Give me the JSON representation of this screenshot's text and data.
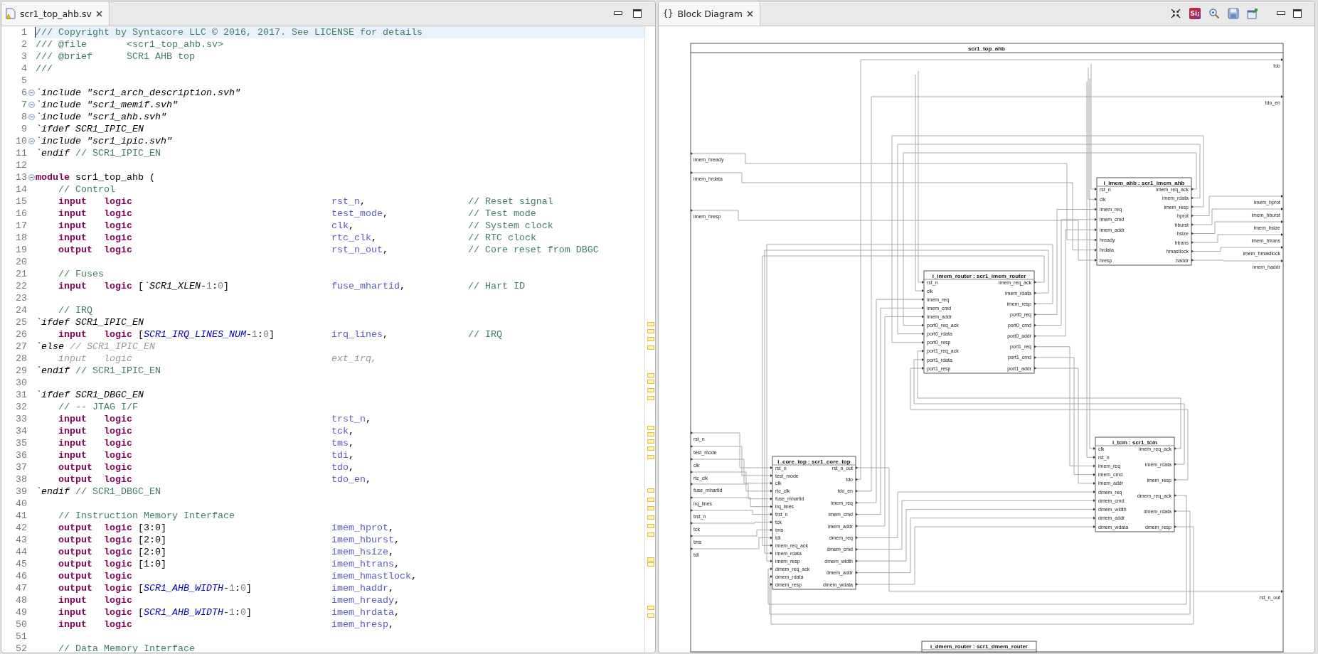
{
  "editor": {
    "tab": {
      "title": "scr1_top_ahb.sv",
      "selected": true
    },
    "lines": [
      {
        "number": "1",
        "current": true,
        "fold": false,
        "segments": [
          {
            "kind": "comment",
            "text": "/// Copyright by Syntacore LLC © 2016, 2017. See LICENSE for details"
          }
        ]
      },
      {
        "number": "2",
        "current": false,
        "fold": false,
        "segments": [
          {
            "kind": "comment",
            "text": "/// @file       <scr1_top_ahb.sv>"
          }
        ]
      },
      {
        "number": "3",
        "current": false,
        "fold": false,
        "segments": [
          {
            "kind": "comment",
            "text": "/// @brief      SCR1 AHB top"
          }
        ]
      },
      {
        "number": "4",
        "current": false,
        "fold": false,
        "segments": [
          {
            "kind": "comment",
            "text": "///"
          }
        ]
      },
      {
        "number": "5",
        "current": false,
        "fold": false
      },
      {
        "number": "6",
        "current": false,
        "fold": true,
        "segments": [
          {
            "kind": "directive",
            "text": "`include \"scr1_arch_description.svh\""
          }
        ]
      },
      {
        "number": "7",
        "current": false,
        "fold": true,
        "segments": [
          {
            "kind": "directive",
            "text": "`include \"scr1_memif.svh\""
          }
        ]
      },
      {
        "number": "8",
        "current": false,
        "fold": true,
        "segments": [
          {
            "kind": "directive",
            "text": "`include \"scr1_ahb.svh\""
          }
        ]
      },
      {
        "number": "9",
        "current": false,
        "fold": false,
        "segments": [
          {
            "kind": "directive",
            "text": "`ifdef SCR1_IPIC_EN"
          }
        ]
      },
      {
        "number": "10",
        "current": false,
        "fold": true,
        "segments": [
          {
            "kind": "directive",
            "text": "`include \"scr1_ipic.svh\""
          }
        ]
      },
      {
        "number": "11",
        "current": false,
        "fold": false,
        "segments": [
          {
            "kind": "directive",
            "text": "`endif"
          },
          {
            "kind": "comment",
            "text": " // SCR1_IPIC_EN"
          }
        ]
      },
      {
        "number": "12",
        "current": false,
        "fold": false
      },
      {
        "number": "13",
        "current": false,
        "fold": true,
        "segments": [
          {
            "kind": "keyword",
            "text": "module"
          },
          {
            "kind": "plain",
            "text": " scr1_top_ahb ("
          }
        ]
      },
      {
        "number": "14",
        "current": false,
        "fold": false,
        "segments": [
          {
            "kind": "comment",
            "text": "    // Control"
          }
        ]
      },
      {
        "number": "15",
        "current": false,
        "fold": false,
        "segments": [
          {
            "kind": "keyword",
            "text": "    input"
          },
          {
            "kind": "keyword",
            "text": "   logic"
          },
          {
            "kind": "port",
            "text": "                                   rst_n"
          },
          {
            "kind": "plain",
            "text": ",                  "
          },
          {
            "kind": "comment",
            "text": "// Reset signal"
          }
        ]
      },
      {
        "number": "16",
        "current": false,
        "fold": false,
        "segments": [
          {
            "kind": "keyword",
            "text": "    input"
          },
          {
            "kind": "keyword",
            "text": "   logic"
          },
          {
            "kind": "port",
            "text": "                                   test_mode"
          },
          {
            "kind": "plain",
            "text": ",              "
          },
          {
            "kind": "comment",
            "text": "// Test mode"
          }
        ]
      },
      {
        "number": "17",
        "current": false,
        "fold": false,
        "segments": [
          {
            "kind": "keyword",
            "text": "    input"
          },
          {
            "kind": "keyword",
            "text": "   logic"
          },
          {
            "kind": "port",
            "text": "                                   clk"
          },
          {
            "kind": "plain",
            "text": ",                    "
          },
          {
            "kind": "comment",
            "text": "// System clock"
          }
        ]
      },
      {
        "number": "18",
        "current": false,
        "fold": false,
        "segments": [
          {
            "kind": "keyword",
            "text": "    input"
          },
          {
            "kind": "keyword",
            "text": "   logic"
          },
          {
            "kind": "port",
            "text": "                                   rtc_clk"
          },
          {
            "kind": "plain",
            "text": ",                "
          },
          {
            "kind": "comment",
            "text": "// RTC clock"
          }
        ]
      },
      {
        "number": "19",
        "current": false,
        "fold": false,
        "segments": [
          {
            "kind": "keyword",
            "text": "    output"
          },
          {
            "kind": "keyword",
            "text": "  logic"
          },
          {
            "kind": "port",
            "text": "                                   rst_n_out"
          },
          {
            "kind": "plain",
            "text": ",              "
          },
          {
            "kind": "comment",
            "text": "// Core reset from DBGC"
          }
        ]
      },
      {
        "number": "20",
        "current": false,
        "fold": false
      },
      {
        "number": "21",
        "current": false,
        "fold": false,
        "segments": [
          {
            "kind": "comment",
            "text": "    // Fuses"
          }
        ]
      },
      {
        "number": "22",
        "current": false,
        "fold": false,
        "segments": [
          {
            "kind": "keyword",
            "text": "    input"
          },
          {
            "kind": "keyword",
            "text": "   logic"
          },
          {
            "kind": "plain",
            "text": " ["
          },
          {
            "kind": "directive",
            "text": "`SCR1_XLEN"
          },
          {
            "kind": "plain",
            "text": "-"
          },
          {
            "kind": "number",
            "text": "1"
          },
          {
            "kind": "plain",
            "text": ":"
          },
          {
            "kind": "number",
            "text": "0"
          },
          {
            "kind": "plain",
            "text": "]"
          },
          {
            "kind": "port",
            "text": "                  fuse_mhartid"
          },
          {
            "kind": "plain",
            "text": ",           "
          },
          {
            "kind": "comment",
            "text": "// Hart ID"
          }
        ]
      },
      {
        "number": "23",
        "current": false,
        "fold": false
      },
      {
        "number": "24",
        "current": false,
        "fold": false,
        "segments": [
          {
            "kind": "comment",
            "text": "    // IRQ"
          }
        ]
      },
      {
        "number": "25",
        "current": false,
        "fold": false,
        "segments": [
          {
            "kind": "directive",
            "text": "`ifdef SCR1_IPIC_EN"
          }
        ]
      },
      {
        "number": "26",
        "current": false,
        "fold": false,
        "segments": [
          {
            "kind": "keyword",
            "text": "    input"
          },
          {
            "kind": "keyword",
            "text": "   logic"
          },
          {
            "kind": "plain",
            "text": " ["
          },
          {
            "kind": "macro",
            "text": "SCR1_IRQ_LINES_NUM"
          },
          {
            "kind": "plain",
            "text": "-"
          },
          {
            "kind": "number",
            "text": "1"
          },
          {
            "kind": "plain",
            "text": ":"
          },
          {
            "kind": "number",
            "text": "0"
          },
          {
            "kind": "plain",
            "text": "]"
          },
          {
            "kind": "port",
            "text": "          irq_lines"
          },
          {
            "kind": "plain",
            "text": ",              "
          },
          {
            "kind": "comment",
            "text": "// IRQ"
          }
        ]
      },
      {
        "number": "27",
        "current": false,
        "fold": false,
        "segments": [
          {
            "kind": "directive",
            "text": "`else"
          },
          {
            "kind": "inactive",
            "text": " // SCR1_IPIC_EN"
          }
        ]
      },
      {
        "number": "28",
        "current": false,
        "fold": false,
        "segments": [
          {
            "kind": "inactive",
            "text": "    input   logic                                   ext_irq,"
          }
        ]
      },
      {
        "number": "29",
        "current": false,
        "fold": false,
        "segments": [
          {
            "kind": "directive",
            "text": "`endif"
          },
          {
            "kind": "comment",
            "text": " // SCR1_IPIC_EN"
          }
        ]
      },
      {
        "number": "30",
        "current": false,
        "fold": false
      },
      {
        "number": "31",
        "current": false,
        "fold": false,
        "segments": [
          {
            "kind": "directive",
            "text": "`ifdef SCR1_DBGC_EN"
          }
        ]
      },
      {
        "number": "32",
        "current": false,
        "fold": false,
        "segments": [
          {
            "kind": "comment",
            "text": "    // -- JTAG I/F"
          }
        ]
      },
      {
        "number": "33",
        "current": false,
        "fold": false,
        "segments": [
          {
            "kind": "keyword",
            "text": "    input"
          },
          {
            "kind": "keyword",
            "text": "   logic"
          },
          {
            "kind": "port",
            "text": "                                   trst_n"
          },
          {
            "kind": "plain",
            "text": ","
          }
        ]
      },
      {
        "number": "34",
        "current": false,
        "fold": false,
        "segments": [
          {
            "kind": "keyword",
            "text": "    input"
          },
          {
            "kind": "keyword",
            "text": "   logic"
          },
          {
            "kind": "port",
            "text": "                                   tck"
          },
          {
            "kind": "plain",
            "text": ","
          }
        ]
      },
      {
        "number": "35",
        "current": false,
        "fold": false,
        "segments": [
          {
            "kind": "keyword",
            "text": "    input"
          },
          {
            "kind": "keyword",
            "text": "   logic"
          },
          {
            "kind": "port",
            "text": "                                   tms"
          },
          {
            "kind": "plain",
            "text": ","
          }
        ]
      },
      {
        "number": "36",
        "current": false,
        "fold": false,
        "segments": [
          {
            "kind": "keyword",
            "text": "    input"
          },
          {
            "kind": "keyword",
            "text": "   logic"
          },
          {
            "kind": "port",
            "text": "                                   tdi"
          },
          {
            "kind": "plain",
            "text": ","
          }
        ]
      },
      {
        "number": "37",
        "current": false,
        "fold": false,
        "segments": [
          {
            "kind": "keyword",
            "text": "    output"
          },
          {
            "kind": "keyword",
            "text": "  logic"
          },
          {
            "kind": "port",
            "text": "                                   tdo"
          },
          {
            "kind": "plain",
            "text": ","
          }
        ]
      },
      {
        "number": "38",
        "current": false,
        "fold": false,
        "segments": [
          {
            "kind": "keyword",
            "text": "    output"
          },
          {
            "kind": "keyword",
            "text": "  logic"
          },
          {
            "kind": "port",
            "text": "                                   tdo_en"
          },
          {
            "kind": "plain",
            "text": ","
          }
        ]
      },
      {
        "number": "39",
        "current": false,
        "fold": false,
        "segments": [
          {
            "kind": "directive",
            "text": "`endif"
          },
          {
            "kind": "comment",
            "text": " // SCR1_DBGC_EN"
          }
        ]
      },
      {
        "number": "40",
        "current": false,
        "fold": false
      },
      {
        "number": "41",
        "current": false,
        "fold": false,
        "segments": [
          {
            "kind": "comment",
            "text": "    // Instruction Memory Interface"
          }
        ]
      },
      {
        "number": "42",
        "current": false,
        "fold": false,
        "segments": [
          {
            "kind": "keyword",
            "text": "    output"
          },
          {
            "kind": "keyword",
            "text": "  logic"
          },
          {
            "kind": "plain",
            "text": " [3:0]"
          },
          {
            "kind": "port",
            "text": "                             imem_hprot"
          },
          {
            "kind": "plain",
            "text": ","
          }
        ]
      },
      {
        "number": "43",
        "current": false,
        "fold": false,
        "segments": [
          {
            "kind": "keyword",
            "text": "    output"
          },
          {
            "kind": "keyword",
            "text": "  logic"
          },
          {
            "kind": "plain",
            "text": " [2:0]"
          },
          {
            "kind": "port",
            "text": "                             imem_hburst"
          },
          {
            "kind": "plain",
            "text": ","
          }
        ]
      },
      {
        "number": "44",
        "current": false,
        "fold": false,
        "segments": [
          {
            "kind": "keyword",
            "text": "    output"
          },
          {
            "kind": "keyword",
            "text": "  logic"
          },
          {
            "kind": "plain",
            "text": " [2:0]"
          },
          {
            "kind": "port",
            "text": "                             imem_hsize"
          },
          {
            "kind": "plain",
            "text": ","
          }
        ]
      },
      {
        "number": "45",
        "current": false,
        "fold": false,
        "segments": [
          {
            "kind": "keyword",
            "text": "    output"
          },
          {
            "kind": "keyword",
            "text": "  logic"
          },
          {
            "kind": "plain",
            "text": " [1:0]"
          },
          {
            "kind": "port",
            "text": "                             imem_htrans"
          },
          {
            "kind": "plain",
            "text": ","
          }
        ]
      },
      {
        "number": "46",
        "current": false,
        "fold": false,
        "segments": [
          {
            "kind": "keyword",
            "text": "    output"
          },
          {
            "kind": "keyword",
            "text": "  logic"
          },
          {
            "kind": "port",
            "text": "                                   imem_hmastlock"
          },
          {
            "kind": "plain",
            "text": ","
          }
        ]
      },
      {
        "number": "47",
        "current": false,
        "fold": false,
        "segments": [
          {
            "kind": "keyword",
            "text": "    output"
          },
          {
            "kind": "keyword",
            "text": "  logic"
          },
          {
            "kind": "plain",
            "text": " ["
          },
          {
            "kind": "macro",
            "text": "SCR1_AHB_WIDTH"
          },
          {
            "kind": "plain",
            "text": "-"
          },
          {
            "kind": "number",
            "text": "1"
          },
          {
            "kind": "plain",
            "text": ":"
          },
          {
            "kind": "number",
            "text": "0"
          },
          {
            "kind": "plain",
            "text": "]"
          },
          {
            "kind": "port",
            "text": "              imem_haddr"
          },
          {
            "kind": "plain",
            "text": ","
          }
        ]
      },
      {
        "number": "48",
        "current": false,
        "fold": false,
        "segments": [
          {
            "kind": "keyword",
            "text": "    input"
          },
          {
            "kind": "keyword",
            "text": "   logic"
          },
          {
            "kind": "port",
            "text": "                                   imem_hready"
          },
          {
            "kind": "plain",
            "text": ","
          }
        ]
      },
      {
        "number": "49",
        "current": false,
        "fold": false,
        "segments": [
          {
            "kind": "keyword",
            "text": "    input"
          },
          {
            "kind": "keyword",
            "text": "   logic"
          },
          {
            "kind": "plain",
            "text": " ["
          },
          {
            "kind": "macro",
            "text": "SCR1_AHB_WIDTH"
          },
          {
            "kind": "plain",
            "text": "-"
          },
          {
            "kind": "number",
            "text": "1"
          },
          {
            "kind": "plain",
            "text": ":"
          },
          {
            "kind": "number",
            "text": "0"
          },
          {
            "kind": "plain",
            "text": "]"
          },
          {
            "kind": "port",
            "text": "              imem_hrdata"
          },
          {
            "kind": "plain",
            "text": ","
          }
        ]
      },
      {
        "number": "50",
        "current": false,
        "fold": false,
        "segments": [
          {
            "kind": "keyword",
            "text": "    input"
          },
          {
            "kind": "keyword",
            "text": "   logic"
          },
          {
            "kind": "port",
            "text": "                                   imem_hresp"
          },
          {
            "kind": "plain",
            "text": ","
          }
        ]
      },
      {
        "number": "51",
        "current": false,
        "fold": false
      },
      {
        "number": "52",
        "current": false,
        "fold": false,
        "segments": [
          {
            "kind": "comment",
            "text": "    // Data Memory Interface"
          }
        ]
      }
    ]
  },
  "diagram": {
    "tab": {
      "icon": "{}",
      "title": "Block Diagram",
      "selected": true
    },
    "toolbar": {
      "logo": "Si;"
    },
    "top_module": {
      "title": "scr1_top_ahb",
      "inputs": [
        "imem_hready",
        "imem_hrdata",
        "imem_hresp",
        "rst_n",
        "test_mode",
        "clk",
        "rtc_clk",
        "fuse_mhartid",
        "irq_lines",
        "trst_n",
        "tck",
        "tms",
        "tdi"
      ],
      "outputs": [
        "tdo",
        "tdo_en",
        "imem_hprot",
        "imem_hburst",
        "imem_hsize",
        "imem_htrans",
        "imem_hmastlock",
        "imem_haddr",
        "rst_n_out"
      ]
    },
    "blocks": [
      {
        "title": "i_imem_ahb : scr1_imem_ahb",
        "inputs": [
          "rst_n",
          "clk",
          "imem_req",
          "imem_cmd",
          "imem_addr",
          "hready",
          "hrdata",
          "hresp"
        ],
        "outputs": [
          "imem_req_ack",
          "imem_rdata",
          "imem_resp",
          "hprot",
          "hburst",
          "hsize",
          "htrans",
          "hmastlock",
          "haddr"
        ]
      },
      {
        "title": "i_imem_router : scr1_imem_router",
        "inputs": [
          "rst_n",
          "clk",
          "imem_req",
          "imem_cmd",
          "imem_addr",
          "port0_req_ack",
          "port0_rdata",
          "port0_resp",
          "port1_req_ack",
          "port1_rdata",
          "port1_resp"
        ],
        "outputs": [
          "imem_req_ack",
          "imem_rdata",
          "imem_resp",
          "port0_req",
          "port0_cmd",
          "port0_addr",
          "port1_req",
          "port1_cmd",
          "port1_addr"
        ]
      },
      {
        "title": "i_core_top : scr1_core_top",
        "inputs": [
          "rst_n",
          "test_mode",
          "clk",
          "rtc_clk",
          "fuse_mhartid",
          "irq_lines",
          "trst_n",
          "tck",
          "tms",
          "tdi",
          "imem_req_ack",
          "imem_rdata",
          "imem_resp",
          "dmem_req_ack",
          "dmem_rdata",
          "dmem_resp"
        ],
        "outputs": [
          "rst_n_out",
          "tdo",
          "tdo_en",
          "imem_req",
          "imem_cmd",
          "imem_addr",
          "dmem_req",
          "dmem_cmd",
          "dmem_width",
          "dmem_addr",
          "dmem_wdata"
        ]
      },
      {
        "title": "i_tcm : scr1_tcm",
        "inputs": [
          "clk",
          "rst_n",
          "imem_req",
          "imem_cmd",
          "imem_addr",
          "dmem_req",
          "dmem_cmd",
          "dmem_width",
          "dmem_addr",
          "dmem_wdata"
        ],
        "outputs": [
          "imem_req_ack",
          "imem_rdata",
          "imem_resp",
          "dmem_req_ack",
          "dmem_rdata",
          "dmem_resp"
        ]
      },
      {
        "title": "i_dmem_router : scr1_dmem_router"
      }
    ]
  }
}
